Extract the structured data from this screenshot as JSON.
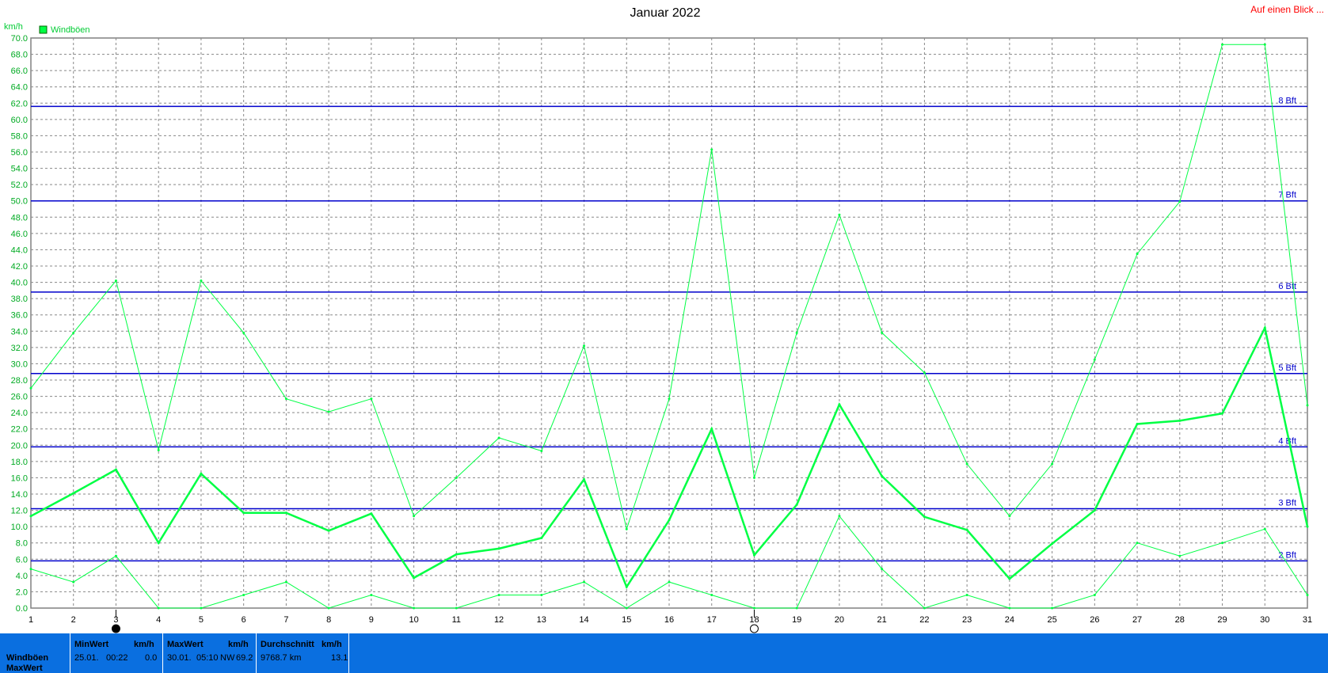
{
  "header": {
    "title": "Januar 2022",
    "link_label": "Auf einen Blick ..."
  },
  "colors": {
    "series": "#00ff44",
    "bft_lines": "#0000cc",
    "grid": "#888888",
    "stats_bg": "#0a6fe0",
    "link": "#ff0000"
  },
  "chart_data": {
    "type": "line",
    "ylabel": "km/h",
    "ylim": [
      0,
      70
    ],
    "y_tick_step": 2,
    "grid": true,
    "legend": "top-left",
    "legend_entries": [
      "Windböen"
    ],
    "x": [
      1,
      2,
      3,
      4,
      5,
      6,
      7,
      8,
      9,
      10,
      11,
      12,
      13,
      14,
      15,
      16,
      17,
      18,
      19,
      20,
      21,
      22,
      23,
      24,
      25,
      26,
      27,
      28,
      29,
      30,
      31
    ],
    "series": [
      {
        "name": "Windböen",
        "role": "average",
        "values": [
          11.3,
          14.1,
          17.0,
          8.0,
          16.5,
          11.7,
          11.7,
          9.5,
          11.6,
          3.7,
          6.6,
          7.3,
          8.6,
          15.8,
          2.6,
          10.8,
          22.0,
          6.5,
          12.7,
          25.0,
          16.2,
          11.2,
          9.6,
          3.6,
          7.9,
          12.0,
          22.6,
          23.0,
          23.9,
          34.4,
          10.0
        ]
      },
      {
        "role": "max",
        "values": [
          27.0,
          33.8,
          40.2,
          19.4,
          40.2,
          33.8,
          25.7,
          24.1,
          25.7,
          11.3,
          16.0,
          20.9,
          19.3,
          32.2,
          9.7,
          25.7,
          56.3,
          16.0,
          33.8,
          48.3,
          33.8,
          28.9,
          17.7,
          11.3,
          17.7,
          30.5,
          43.5,
          49.9,
          69.2,
          69.2,
          24.9
        ]
      },
      {
        "role": "min",
        "values": [
          4.8,
          3.2,
          6.4,
          0.0,
          0.0,
          1.6,
          3.2,
          0.0,
          1.6,
          0.0,
          0.0,
          1.6,
          1.6,
          3.2,
          0.0,
          3.2,
          1.6,
          0.0,
          0.0,
          11.3,
          4.8,
          0.0,
          1.6,
          0.0,
          0.0,
          1.6,
          8.0,
          6.4,
          8.0,
          9.7,
          1.6
        ]
      }
    ],
    "reference_lines": [
      {
        "label": "2 Bft",
        "value": 5.8
      },
      {
        "label": "3 Bft",
        "value": 12.2
      },
      {
        "label": "4 Bft",
        "value": 19.8
      },
      {
        "label": "5 Bft",
        "value": 28.8
      },
      {
        "label": "6 Bft",
        "value": 38.8
      },
      {
        "label": "7 Bft",
        "value": 50.0
      },
      {
        "label": "8 Bft",
        "value": 61.6
      }
    ],
    "moon_markers": [
      {
        "day": 3,
        "phase": "new-moon"
      },
      {
        "day": 18,
        "phase": "full-moon"
      }
    ]
  },
  "stats": {
    "row_labels": [
      "Windböen",
      "MaxWert"
    ],
    "min": {
      "head": "MinWert",
      "unit": "km/h",
      "date": "25.01.",
      "time": "00:22",
      "value": "0.0"
    },
    "max": {
      "head": "MaxWert",
      "unit": "km/h",
      "date": "30.01.",
      "time": "05:10",
      "dir": "NW",
      "value": "69.2"
    },
    "avg": {
      "head": "Durchschnitt",
      "unit": "km/h",
      "dist": "9768.7 km",
      "value": "13.1"
    }
  }
}
